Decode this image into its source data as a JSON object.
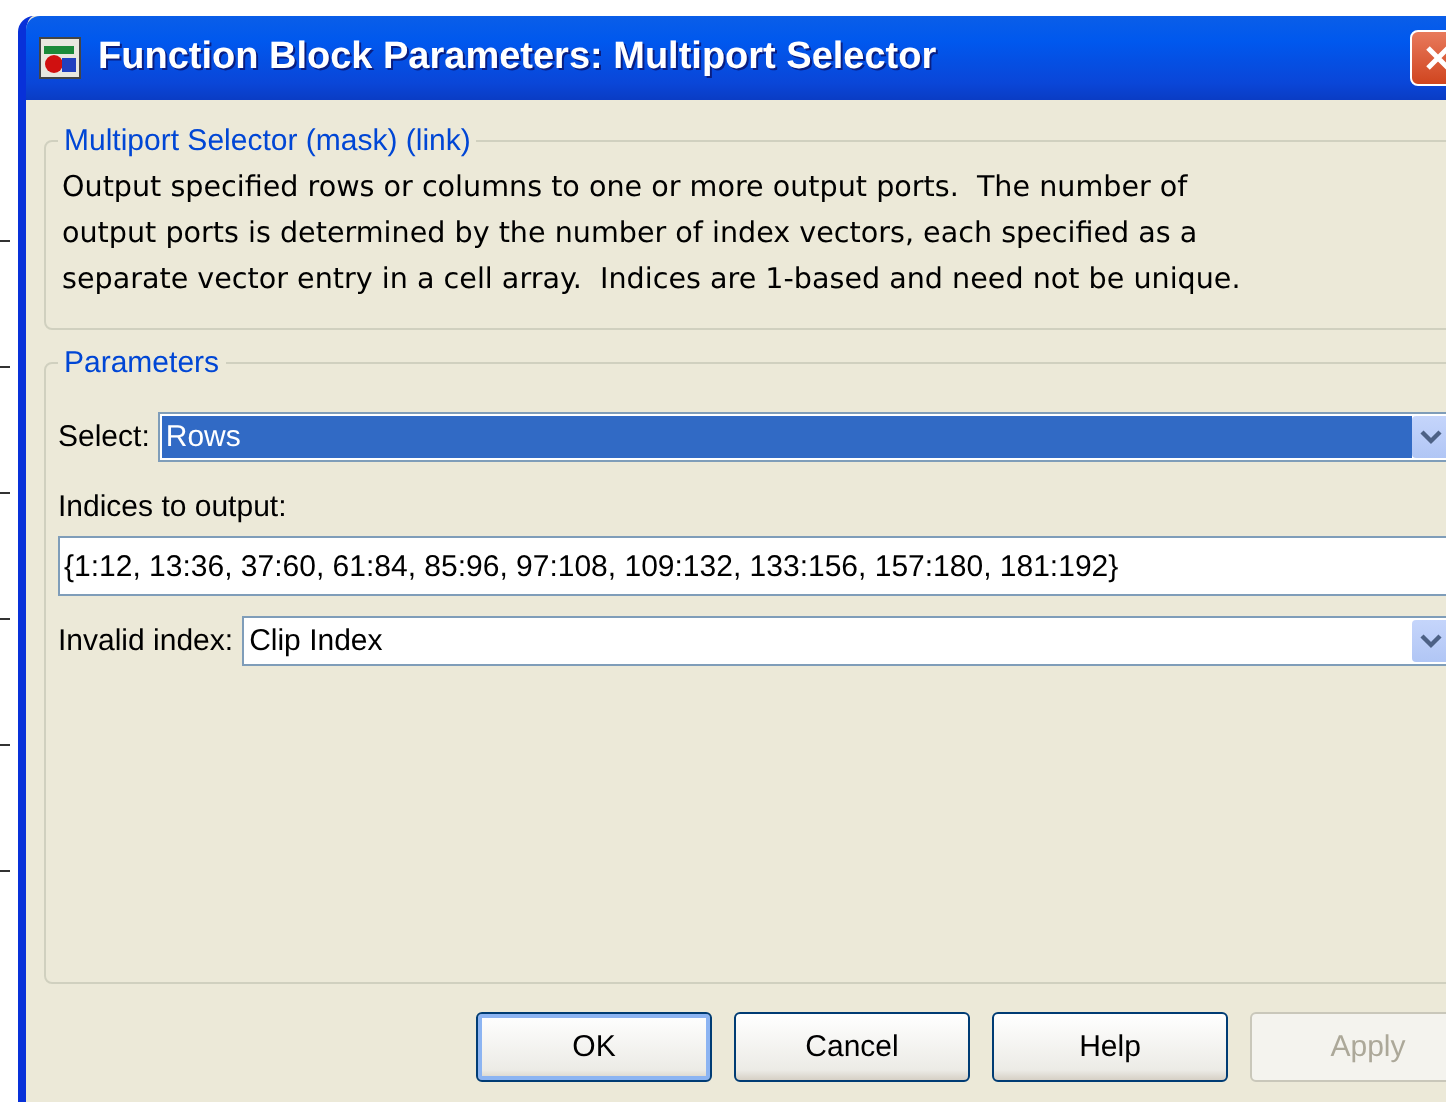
{
  "window": {
    "title": "Function Block Parameters: Multiport Selector"
  },
  "description_group": {
    "legend": "Multiport Selector (mask) (link)",
    "text_lines": [
      "Output specified rows or columns to one or more output ports.  The number of",
      "output ports is determined by the number of index vectors, each specified as a",
      "separate vector entry in a cell array.  Indices are 1-based and need not be unique."
    ]
  },
  "parameters": {
    "legend": "Parameters",
    "select": {
      "label": "Select:",
      "value": "Rows",
      "focused": true
    },
    "indices": {
      "label": "Indices to output:",
      "value": "{1:12, 13:36, 37:60, 61:84, 85:96, 97:108, 109:132, 133:156, 157:180, 181:192}"
    },
    "invalid_index": {
      "label": "Invalid index:",
      "value": "Clip Index",
      "focused": false
    }
  },
  "buttons": [
    {
      "label": "OK",
      "default": true,
      "disabled": false
    },
    {
      "label": "Cancel",
      "default": false,
      "disabled": false
    },
    {
      "label": "Help",
      "default": false,
      "disabled": false
    },
    {
      "label": "Apply",
      "default": false,
      "disabled": true
    }
  ]
}
